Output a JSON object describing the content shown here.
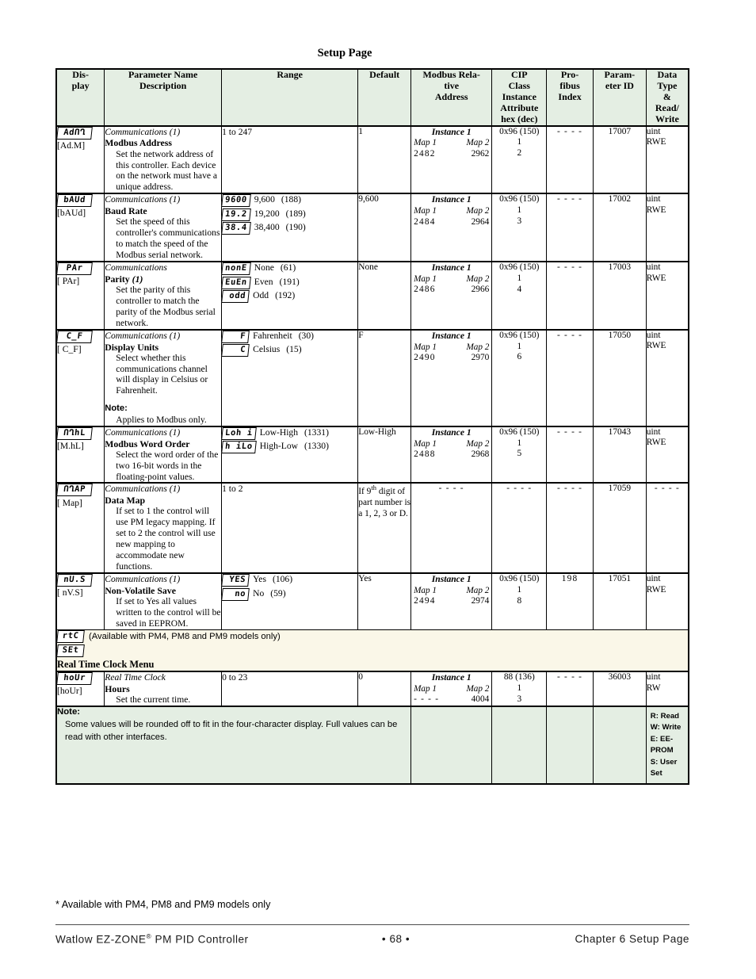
{
  "page_title": "Setup Page",
  "table_headers": [
    "Dis-\nplay",
    "Parameter Name\nDescription",
    "Range",
    "Default",
    "Modbus Rela-\ntive\nAddress",
    "CIP\nClass\nInstance\nAttribute\nhex (dec)",
    "Pro-\nfibus\nIndex",
    "Param-\neter ID",
    "Data\nType\n&\nRead/\nWrite"
  ],
  "header_cells": {
    "display": "Dis-play",
    "display_l1": "Dis-",
    "display_l2": "play",
    "param_l1": "Parameter Name",
    "param_l2": "Description",
    "range": "Range",
    "default": "Default",
    "modbus_l1": "Modbus Rela-",
    "modbus_l2": "tive",
    "modbus_l3": "Address",
    "cip_l1": "CIP",
    "cip_l2": "Class",
    "cip_l3": "Instance",
    "cip_l4": "Attribute",
    "cip_l5": "hex (dec)",
    "profibus_l1": "Pro-",
    "profibus_l2": "fibus",
    "profibus_l3": "Index",
    "paramid_l1": "Param-",
    "paramid_l2": "eter ID",
    "datatype_l1": "Data",
    "datatype_l2": "Type",
    "datatype_l3": "&",
    "datatype_l4": "Read/",
    "datatype_l5": "Write"
  },
  "rows": [
    {
      "display_seg": "AdՈՂ",
      "display_code": "[Ad.M]",
      "group": "Communications (1)",
      "name": "Modbus Address",
      "desc": "Set the network address of this controller. Each device on the network must have a unique address.",
      "range_plain": "1 to 247",
      "default": "1",
      "modbus_instance": "Instance 1",
      "modbus_map1_label": "Map 1",
      "modbus_map2_label": "Map 2",
      "modbus_map1": "2482",
      "modbus_map2": "2962",
      "cip_class": "0x96 (150)",
      "cip_instance": "1",
      "cip_attribute": "2",
      "profibus": "- - - -",
      "param_id": "17007",
      "data_type": "uint",
      "read_write": "RWE"
    },
    {
      "display_seg": "bAUd",
      "display_code": "[bAUd]",
      "group": "Communications (1)",
      "name": "Baud Rate",
      "desc": "Set the speed of this controller's communications to match the speed of the Modbus serial network.",
      "options": [
        {
          "seg": "9600",
          "label": "9,600",
          "code": "(188)"
        },
        {
          "seg": "19.2",
          "label": "19,200",
          "code": "(189)"
        },
        {
          "seg": "38.4",
          "label": "38,400",
          "code": "(190)"
        }
      ],
      "default": "9,600",
      "modbus_instance": "Instance 1",
      "modbus_map1_label": "Map 1",
      "modbus_map2_label": "Map 2",
      "modbus_map1": "2484",
      "modbus_map2": "2964",
      "cip_class": "0x96 (150)",
      "cip_instance": "1",
      "cip_attribute": "3",
      "profibus": "- - - -",
      "param_id": "17002",
      "data_type": "uint",
      "read_write": "RWE"
    },
    {
      "display_seg": "PAr",
      "display_code": "[ PAr]",
      "group": "Communications",
      "name": "Parity",
      "name_suffix": "(1)",
      "desc": "Set the parity of this controller to match the parity of the Modbus serial network.",
      "options": [
        {
          "seg": "nonE",
          "label": "None",
          "code": "(61)"
        },
        {
          "seg": "EuEn",
          "label": "Even",
          "code": "(191)"
        },
        {
          "seg": "odd",
          "label": "Odd",
          "code": "(192)"
        }
      ],
      "default": "None",
      "modbus_instance": "Instance 1",
      "modbus_map1_label": "Map 1",
      "modbus_map2_label": "Map 2",
      "modbus_map1": "2486",
      "modbus_map2": "2966",
      "cip_class": "0x96 (150)",
      "cip_instance": "1",
      "cip_attribute": "4",
      "profibus": "- - - -",
      "param_id": "17003",
      "data_type": "uint",
      "read_write": "RWE"
    },
    {
      "display_seg": "C_F",
      "display_code": "[ C_F]",
      "group": "Communications (1)",
      "name": "Display Units",
      "desc": "Select whether this communications channel will display in Celsius or Fahrenheit.",
      "note_label": "Note:",
      "note_text": "Applies to Modbus only.",
      "options": [
        {
          "seg": "F",
          "label": "Fahrenheit",
          "code": "(30)"
        },
        {
          "seg": "C",
          "label": "Celsius",
          "code": "(15)"
        }
      ],
      "default": "F",
      "modbus_instance": "Instance 1",
      "modbus_map1_label": "Map 1",
      "modbus_map2_label": "Map 2",
      "modbus_map1": "2490",
      "modbus_map2": "2970",
      "cip_class": "0x96 (150)",
      "cip_instance": "1",
      "cip_attribute": "6",
      "profibus": "- - - -",
      "param_id": "17050",
      "data_type": "uint",
      "read_write": "RWE"
    },
    {
      "display_seg": "ՈՂhL",
      "display_code": "[M.hL]",
      "group": "Communications (1)",
      "name": "Modbus Word Order",
      "desc": "Select the word order of the two 16-bit words in the floating-point values.",
      "options": [
        {
          "seg": "Loh i",
          "label": "Low-High",
          "code": "(1331)"
        },
        {
          "seg": "h iLo",
          "label": "High-Low",
          "code": "(1330)"
        }
      ],
      "default": "Low-High",
      "modbus_instance": "Instance 1",
      "modbus_map1_label": "Map 1",
      "modbus_map2_label": "Map 2",
      "modbus_map1": "2488",
      "modbus_map2": "2968",
      "cip_class": "0x96 (150)",
      "cip_instance": "1",
      "cip_attribute": "5",
      "profibus": "- - - -",
      "param_id": "17043",
      "data_type": "uint",
      "read_write": "RWE"
    },
    {
      "display_seg": "ՈՂAP",
      "display_code": "[ Map]",
      "group": "Communications (1)",
      "name": "Data Map",
      "desc": "If set to 1 the control will use PM legacy mapping. If set to 2 the control will use new mapping to accommodate new functions.",
      "range_plain": "1 to 2",
      "default_rich": true,
      "default_pre": "If 9",
      "default_sup": "th",
      "default_post": " digit of part number is a 1, 2, 3 or D.",
      "modbus_dashes": "- - - -",
      "cip_dashes": "- - - -",
      "profibus": "- - - -",
      "param_id": "17059",
      "data_type_dashes": "- - - -"
    },
    {
      "display_seg": "nU.S",
      "display_code": "[ nV.S]",
      "group": "Communications (1)",
      "name": "Non-Volatile Save",
      "desc": "If set to Yes all values written to the control will be saved in EEPROM.",
      "options": [
        {
          "seg": "YES",
          "label": "Yes",
          "code": "(106)"
        },
        {
          "seg": "no",
          "label": "No",
          "code": "(59)"
        }
      ],
      "default": "Yes",
      "modbus_instance": "Instance 1",
      "modbus_map1_label": "Map 1",
      "modbus_map2_label": "Map 2",
      "modbus_map1": "2494",
      "modbus_map2": "2974",
      "cip_class": "0x96 (150)",
      "cip_instance": "1",
      "cip_attribute": "8",
      "profibus": "198",
      "param_id": "17051",
      "data_type": "uint",
      "read_write": "RWE"
    }
  ],
  "banner": {
    "seg1": "rtC",
    "availability": "(Available with PM4, PM8 and PM9 models only)",
    "seg2": "SEt",
    "title": "Real Time Clock Menu"
  },
  "rtc_row": {
    "display_seg": "hoUr",
    "display_code": "[hoUr]",
    "group": "Real Time Clock",
    "name": "Hours",
    "desc": "Set the current time.",
    "range_plain": "0 to 23",
    "default": "0",
    "modbus_instance": "Instance 1",
    "modbus_map1_label": "Map 1",
    "modbus_map2_label": "Map 2",
    "modbus_map1": "- - - -",
    "modbus_map2": "4004",
    "cip_class": "88 (136)",
    "cip_instance": "1",
    "cip_attribute": "3",
    "profibus": "- - - -",
    "param_id": "36003",
    "data_type": "uint",
    "read_write": "RW"
  },
  "bottom_note": {
    "title": "Note:",
    "text": "Some values will be rounded off to fit in the four-character display. Full values can be read with other interfaces."
  },
  "legend": [
    "R: Read",
    "W: Write",
    "E: EE-",
    "PROM",
    "S: User",
    "Set"
  ],
  "footnote": "* Available with PM4, PM8 and PM9 models only",
  "footer": {
    "left_pre": "Watlow EZ-ZONE",
    "left_reg": "®",
    "left_post": " PM PID Controller",
    "center": "•  68  •",
    "right": "Chapter 6 Setup Page"
  },
  "colors": {
    "header_bg": "#e4eee3",
    "banner_bg": "#faf7e8",
    "note_bg": "#e4eee3",
    "border": "#000000"
  }
}
